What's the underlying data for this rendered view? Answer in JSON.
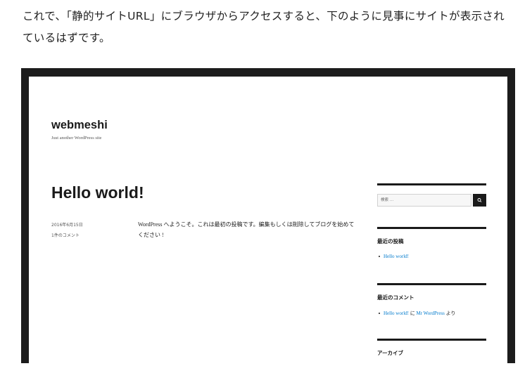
{
  "article": {
    "text": "これで、「静的サイトURL」にブラウザからアクセスすると、下のように見事にサイトが表示されているはずです。"
  },
  "site": {
    "title": "webmeshi",
    "description": "Just another WordPress site"
  },
  "post": {
    "title": "Hello world!",
    "date": "2016年6月15日",
    "comments": "1件のコメント",
    "body": "WordPress へようこそ。これは最初の投稿です。編集もしくは削除してブログを始めてください !"
  },
  "sidebar": {
    "search_placeholder": "検索 …",
    "search_icon": "search-icon",
    "recent_posts_title": "最近の投稿",
    "recent_posts": [
      "Hello world!"
    ],
    "recent_comments_title": "最近のコメント",
    "recent_comment": {
      "post": "Hello world!",
      "connector": "に",
      "author": "Mr WordPress",
      "suffix": "より"
    },
    "archives_title": "アーカイブ"
  },
  "colors": {
    "link": "#007acc",
    "frame": "#1c1c1c",
    "text": "#1a1a1a"
  }
}
